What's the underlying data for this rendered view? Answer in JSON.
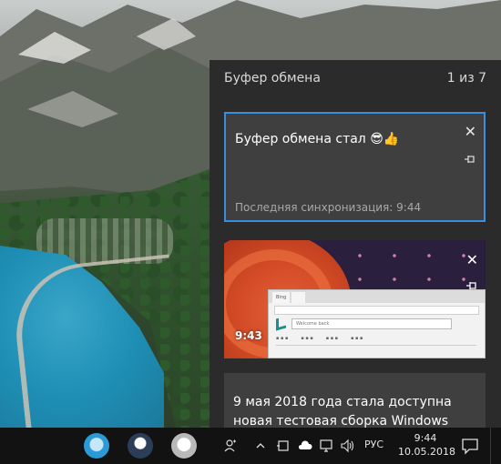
{
  "clipboard": {
    "title": "Буфер обмена",
    "counter": "1 из 7",
    "items": [
      {
        "text": "Буфер обмена стал 😎👍",
        "sync_label": "Последняя синхронизация: 9:44",
        "selected": true
      },
      {
        "type": "image",
        "time": "9:43",
        "browser_tab_1": "Bing",
        "browser_search_text": "Welcome back"
      },
      {
        "text": "9 мая 2018 года стала доступна новая тестовая сборка Windows"
      }
    ],
    "icons": {
      "close": "close-icon",
      "pin": "pin-icon"
    },
    "accent_color": "#3a8de0"
  },
  "taskbar": {
    "apps": [
      "app-icon-1",
      "app-icon-2",
      "app-icon-3"
    ],
    "tray_icons": [
      "people-icon",
      "chevron-up-icon",
      "tablet-icon",
      "cloud-icon",
      "network-icon",
      "volume-icon"
    ],
    "language": "РУС",
    "time": "9:44",
    "date": "10.05.2018",
    "notification_icon": "notification-icon"
  }
}
